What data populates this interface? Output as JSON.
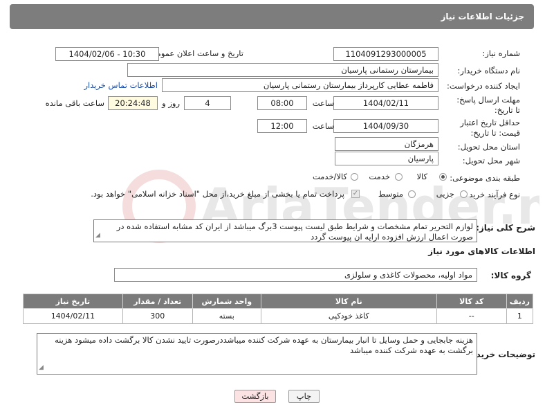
{
  "header": {
    "title": "جزئیات اطلاعات نیاز"
  },
  "labels": {
    "need_number": "شماره نیاز:",
    "announce_datetime": "تاریخ و ساعت اعلان عمومی:",
    "buyer_org": "نام دستگاه خریدار:",
    "requester": "ایجاد کننده درخواست:",
    "reply_deadline": "مهلت ارسال پاسخ: تا تاریخ:",
    "price_validity": "حداقل تاریخ اعتبار قیمت: تا تاریخ:",
    "time": "ساعت",
    "days_and": "روز و",
    "remaining": "ساعت باقی مانده",
    "province": "استان محل تحویل:",
    "city": "شهر محل تحویل:",
    "category": "طبقه بندی موضوعی:",
    "process_type": "نوع فرآیند خرید :",
    "description": "شرح کلی نیاز:",
    "goods_info": "اطلاعات کالاهای مورد نیاز",
    "goods_group": "گروه کالا:",
    "buyer_notes": "توضیحات خریدار:"
  },
  "fields": {
    "need_number": "1104091293000005",
    "announce_datetime": "1404/02/06 - 10:30",
    "buyer_org": "بیمارستان رستمانی پارسیان",
    "requester": "فاطمه عطایی کارپرداز بیمارستان رستمانی پارسیان",
    "contact_link": "اطلاعات تماس خریدار",
    "reply_date": "1404/02/11",
    "reply_time": "08:00",
    "days": "4",
    "remaining_time": "20:24:48",
    "validity_date": "1404/09/30",
    "validity_time": "12:00",
    "province": "هرمزگان",
    "city": "پارسیان"
  },
  "category_options": [
    {
      "label": "کالا",
      "selected": true
    },
    {
      "label": "خدمت",
      "selected": false
    },
    {
      "label": "کالا/خدمت",
      "selected": false
    }
  ],
  "process_options": [
    {
      "label": "جزیی",
      "selected": false
    },
    {
      "label": "متوسط",
      "selected": false
    }
  ],
  "payment_note": "پرداخت تمام یا بخشی از مبلغ خرید،از محل \"اسناد خزانه اسلامی\" خواهد بود.",
  "description_text": "لوازم التحریر تمام مشخصات و شرایط طبق لیست پیوست 3برگ میباشد از ایران کد مشابه استفاده شده در صورت اعمال ارزش افزوده ارایه ان پیوست گردد",
  "goods_group_value": "مواد اولیه، محصولات کاغذی و سلولزی",
  "table": {
    "headers": [
      "ردیف",
      "کد کالا",
      "نام کالا",
      "واحد شمارش",
      "تعداد / مقدار",
      "تاریخ نیاز"
    ],
    "rows": [
      [
        "1",
        "--",
        "کاغذ خودکپی",
        "بسته",
        "300",
        "1404/02/11"
      ]
    ]
  },
  "buyer_notes_text": "هزینه جابجایی و حمل وسایل تا انبار بیمارستان به عهده شرکت کننده میباشددرصورت تایید نشدن کالا برگشت داده میشود هزینه برگشت به عهده شرکت کننده میباشد",
  "buttons": {
    "print": "چاپ",
    "back": "بازگشت"
  },
  "watermark_text": "AriaTender.net",
  "colors": {
    "header_bg": "#7d7d7d",
    "link": "#1a4ea8",
    "back_button_bg": "#fbe3e3"
  }
}
